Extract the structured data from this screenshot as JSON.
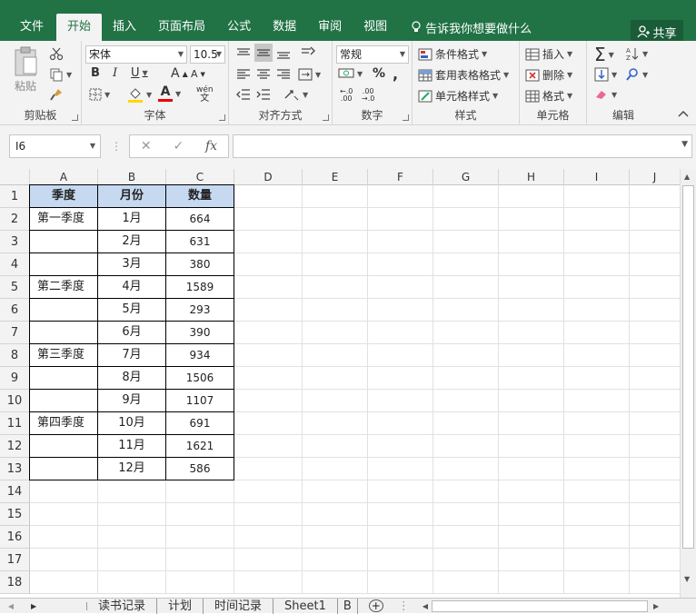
{
  "tabs": {
    "file": "文件",
    "home": "开始",
    "insert": "插入",
    "layout": "页面布局",
    "formulas": "公式",
    "data": "数据",
    "review": "审阅",
    "view": "视图",
    "tell": "告诉我你想要做什么",
    "share": "共享"
  },
  "ribbon": {
    "clipboard": {
      "label": "剪贴板",
      "paste": "粘贴"
    },
    "font": {
      "label": "字体",
      "name": "宋体",
      "size": "10.5",
      "bold": "B",
      "italic": "I",
      "underline": "U",
      "grow": "A",
      "shrink": "A",
      "wen": "wén"
    },
    "align": {
      "label": "对齐方式"
    },
    "number": {
      "label": "数字",
      "format": "常规",
      "percent": "%",
      "comma": ","
    },
    "styles": {
      "label": "样式",
      "cond": "条件格式",
      "table": "套用表格格式",
      "cell": "单元格样式"
    },
    "cells": {
      "label": "单元格",
      "insert": "插入",
      "delete": "删除",
      "format": "格式"
    },
    "edit": {
      "label": "编辑"
    }
  },
  "formula": {
    "namebox": "I6",
    "fx": "fx",
    "value": ""
  },
  "columns": [
    "A",
    "B",
    "C",
    "D",
    "E",
    "F",
    "G",
    "H",
    "I",
    "J"
  ],
  "rows": [
    "1",
    "2",
    "3",
    "4",
    "5",
    "6",
    "7",
    "8",
    "9",
    "10",
    "11",
    "12",
    "13",
    "14",
    "15",
    "16",
    "17",
    "18"
  ],
  "table": {
    "headers": [
      "季度",
      "月份",
      "数量"
    ],
    "data": [
      [
        "第一季度",
        "1月",
        "664"
      ],
      [
        "",
        "2月",
        "631"
      ],
      [
        "",
        "3月",
        "380"
      ],
      [
        "第二季度",
        "4月",
        "1589"
      ],
      [
        "",
        "5月",
        "293"
      ],
      [
        "",
        "6月",
        "390"
      ],
      [
        "第三季度",
        "7月",
        "934"
      ],
      [
        "",
        "8月",
        "1506"
      ],
      [
        "",
        "9月",
        "1107"
      ],
      [
        "第四季度",
        "10月",
        "691"
      ],
      [
        "",
        "11月",
        "1621"
      ],
      [
        "",
        "12月",
        "586"
      ]
    ]
  },
  "sheets": [
    "读书记录",
    "计划",
    "时间记录",
    "Sheet1",
    "B"
  ],
  "colors": {
    "excel_green": "#217346",
    "header_fill": "#c6d9f1"
  }
}
